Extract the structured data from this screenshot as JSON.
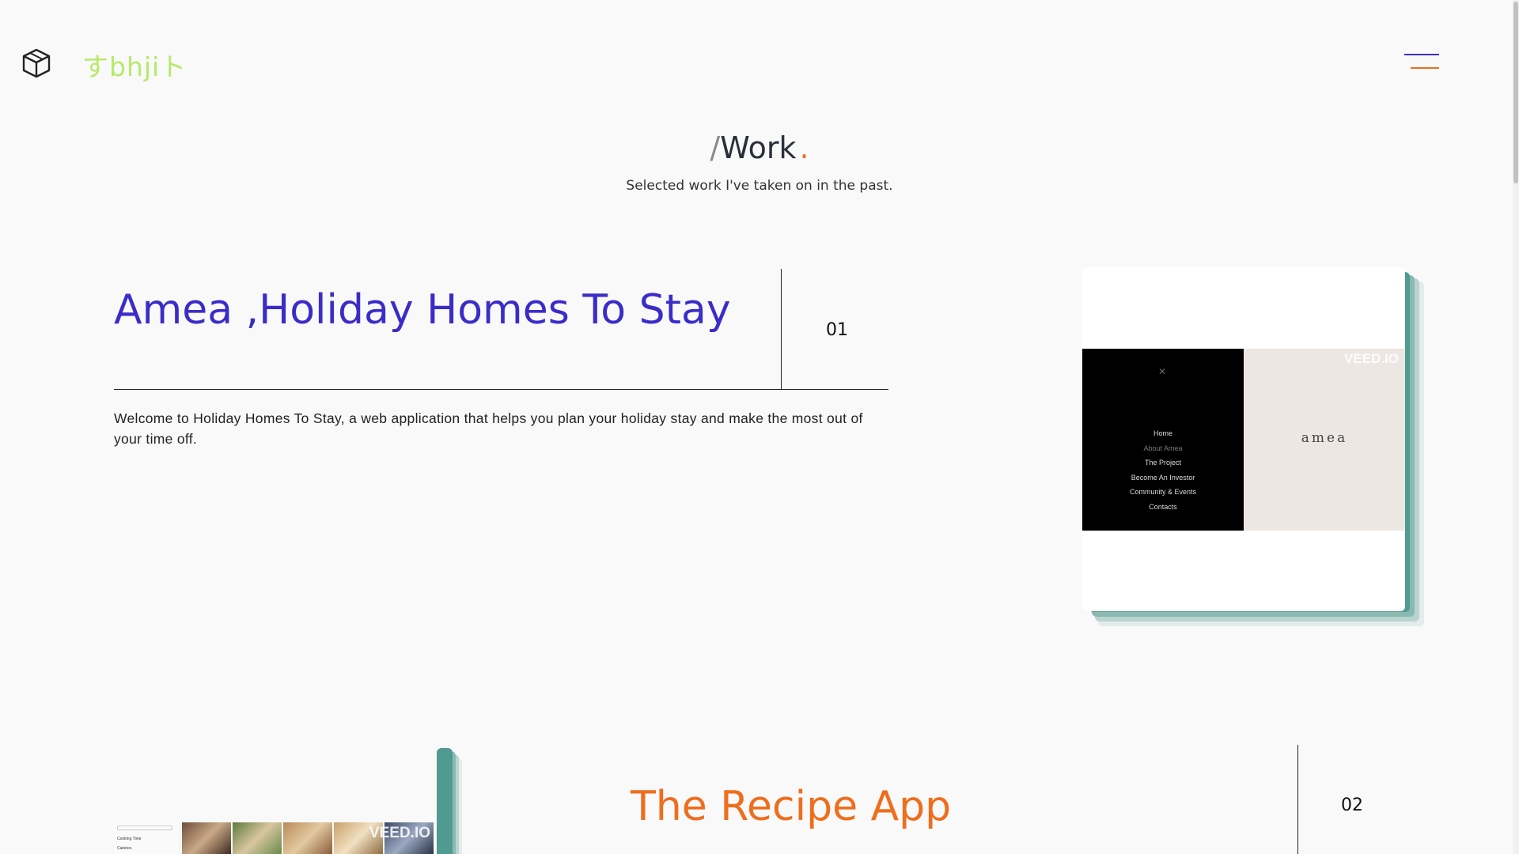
{
  "header": {
    "logo_icon": "cube-icon",
    "brand": "すbhjiト",
    "menu_icon": "hamburger-menu-icon"
  },
  "colors": {
    "accent_purple": "#3b2cc8",
    "accent_orange": "#ee6e1e",
    "brand_green": "#b7e96a",
    "card_teal": "#4f9a91"
  },
  "section": {
    "slash": "/",
    "title": "Work",
    "dot": ".",
    "subtitle": "Selected work I've taken on in the past."
  },
  "projects": [
    {
      "title": "Amea ,Holiday Homes To Stay",
      "number": "01",
      "description": "Welcome to Holiday Homes To Stay, a web application that helps you plan your holiday stay and make the most out of your time off.",
      "preview": {
        "close_icon": "close-icon",
        "menu_items": [
          "Home",
          "About Amea",
          "The Project",
          "Become An Investor",
          "Community & Events",
          "Contacts"
        ],
        "brand": "amea",
        "watermark": "VEED.IO"
      }
    },
    {
      "title": "The Recipe App",
      "number": "02",
      "preview": {
        "sidebar_rows": [
          "Cooking Time",
          "Calories"
        ],
        "watermark": "VEED.IO"
      }
    }
  ]
}
